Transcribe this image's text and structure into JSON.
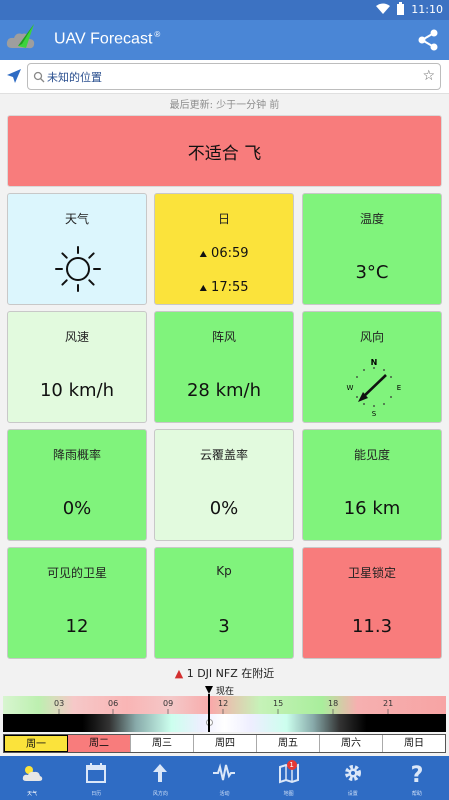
{
  "status_bar": {
    "time": "11:10"
  },
  "app": {
    "title": "UAV Forecast",
    "trademark": "®"
  },
  "search": {
    "value": "未知的位置",
    "placeholder": ""
  },
  "last_updated": "最后更新: 少于一分钟 前",
  "verdict": "不适合 飞",
  "tiles": {
    "weather": {
      "label": "天气",
      "icon": "sun-icon"
    },
    "sun": {
      "label": "日",
      "sunrise": "06:59",
      "sunset": "17:55"
    },
    "temperature": {
      "label": "温度",
      "value": "3°C"
    },
    "wind_speed": {
      "label": "风速",
      "value": "10 km/h"
    },
    "gust": {
      "label": "阵风",
      "value": "28 km/h"
    },
    "wind_direction": {
      "label": "风向",
      "n": "N",
      "e": "E",
      "s": "S",
      "w": "W"
    },
    "precip": {
      "label": "降雨概率",
      "value": "0%"
    },
    "cloud": {
      "label": "云覆盖率",
      "value": "0%"
    },
    "visibility": {
      "label": "能见度",
      "value": "16 km"
    },
    "satellites": {
      "label": "可见的卫星",
      "value": "12"
    },
    "kp": {
      "label": "Kp",
      "value": "3"
    },
    "sat_lock": {
      "label": "卫星锁定",
      "value": "11.3"
    }
  },
  "nfz": {
    "text": "1 DJI NFZ 在附近"
  },
  "timeline": {
    "now_label": "现在",
    "hours": [
      "03",
      "06",
      "09",
      "12",
      "15",
      "18",
      "21"
    ]
  },
  "days": [
    "周一",
    "周二",
    "周三",
    "周四",
    "周五",
    "周六",
    "周日"
  ],
  "nav": {
    "items": [
      {
        "label": "天气",
        "icon": "weather-icon"
      },
      {
        "label": "日历",
        "icon": "calendar-icon"
      },
      {
        "label": "风方向",
        "icon": "arrow-up-icon"
      },
      {
        "label": "活动",
        "icon": "pulse-icon"
      },
      {
        "label": "地图",
        "icon": "map-icon",
        "badge": "1"
      },
      {
        "label": "设置",
        "icon": "gear-icon"
      },
      {
        "label": "帮助",
        "icon": "help-icon"
      }
    ]
  },
  "colors": {
    "app_bar": "#4a86d6",
    "status_bar": "#3c72c2",
    "good": "#80f37c",
    "bad": "#f87c7c",
    "warn_yellow": "#fbe33b",
    "nav_bg": "#2f6cc4"
  }
}
